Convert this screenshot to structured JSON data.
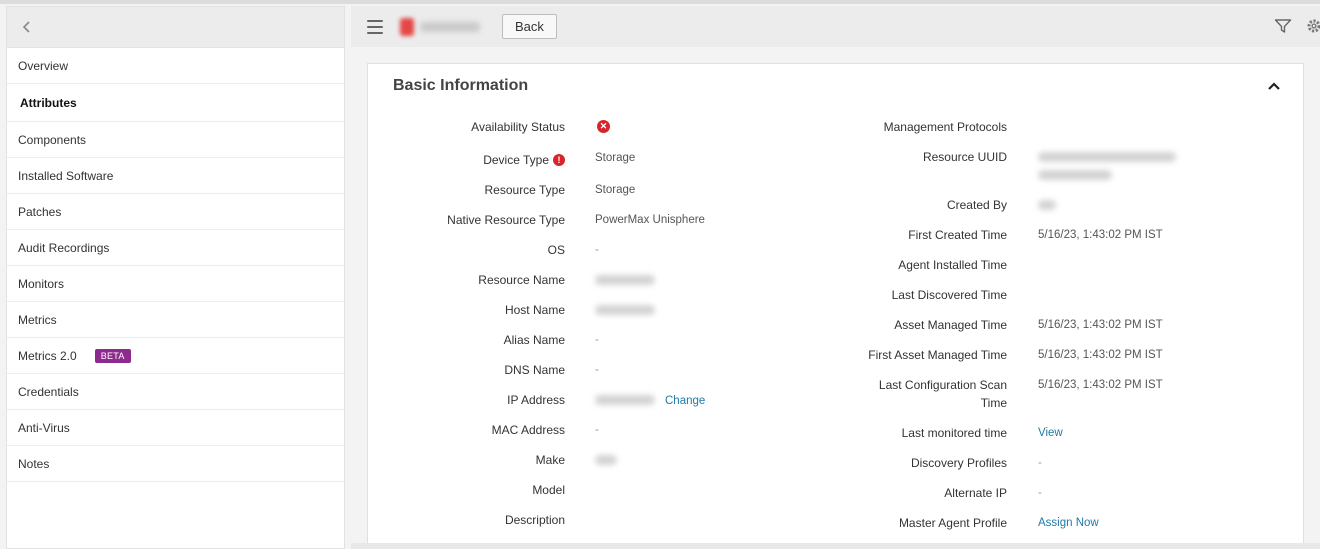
{
  "sidebar": {
    "items": [
      {
        "label": "Overview"
      },
      {
        "label": "Attributes"
      },
      {
        "label": "Components"
      },
      {
        "label": "Installed Software"
      },
      {
        "label": "Patches"
      },
      {
        "label": "Audit Recordings"
      },
      {
        "label": "Monitors"
      },
      {
        "label": "Metrics"
      },
      {
        "label": "Metrics 2.0",
        "badge": "BETA"
      },
      {
        "label": "Credentials"
      },
      {
        "label": "Anti-Virus"
      },
      {
        "label": "Notes"
      }
    ],
    "active": "Attributes"
  },
  "toolbar": {
    "back_label": "Back"
  },
  "panel": {
    "title": "Basic Information",
    "left_fields": [
      {
        "label": "Availability Status",
        "value": ""
      },
      {
        "label": "Device Type",
        "value": "Storage"
      },
      {
        "label": "Resource Type",
        "value": "Storage"
      },
      {
        "label": "Native Resource Type",
        "value": "PowerMax Unisphere"
      },
      {
        "label": "OS",
        "value": "-"
      },
      {
        "label": "Resource Name",
        "value": ""
      },
      {
        "label": "Host Name",
        "value": ""
      },
      {
        "label": "Alias Name",
        "value": "-"
      },
      {
        "label": "DNS Name",
        "value": "-"
      },
      {
        "label": "IP Address",
        "value": "",
        "action": "Change"
      },
      {
        "label": "MAC Address",
        "value": "-"
      },
      {
        "label": "Make",
        "value": ""
      },
      {
        "label": "Model",
        "value": ""
      },
      {
        "label": "Description",
        "value": ""
      }
    ],
    "right_fields": [
      {
        "label": "Management Protocols",
        "value": ""
      },
      {
        "label": "Resource UUID",
        "value": ""
      },
      {
        "label": "Created By",
        "value": ""
      },
      {
        "label": "First Created Time",
        "value": "5/16/23, 1:43:02 PM IST"
      },
      {
        "label": "Agent Installed Time",
        "value": ""
      },
      {
        "label": "Last Discovered Time",
        "value": ""
      },
      {
        "label": "Asset Managed Time",
        "value": "5/16/23, 1:43:02 PM IST"
      },
      {
        "label": "First Asset Managed Time",
        "value": "5/16/23, 1:43:02 PM IST"
      },
      {
        "label": "Last Configuration Scan",
        "label2": "Time",
        "value": "5/16/23, 1:43:02 PM IST"
      },
      {
        "label": "Last monitored time",
        "value": "",
        "action": "View"
      },
      {
        "label": "Discovery Profiles",
        "value": "-"
      },
      {
        "label": "Alternate IP",
        "value": "-"
      },
      {
        "label": "Master Agent Profile",
        "value": "",
        "action": "Assign Now"
      }
    ]
  },
  "colors": {
    "link": "#1f7aa8",
    "beta_badge": "#8e2a8e",
    "status_down": "#d6262c"
  },
  "icons": [
    "chevron-left-icon",
    "hamburger-icon",
    "filter-icon",
    "gear-icon",
    "chevron-up-icon",
    "status-down-icon",
    "info-icon"
  ]
}
